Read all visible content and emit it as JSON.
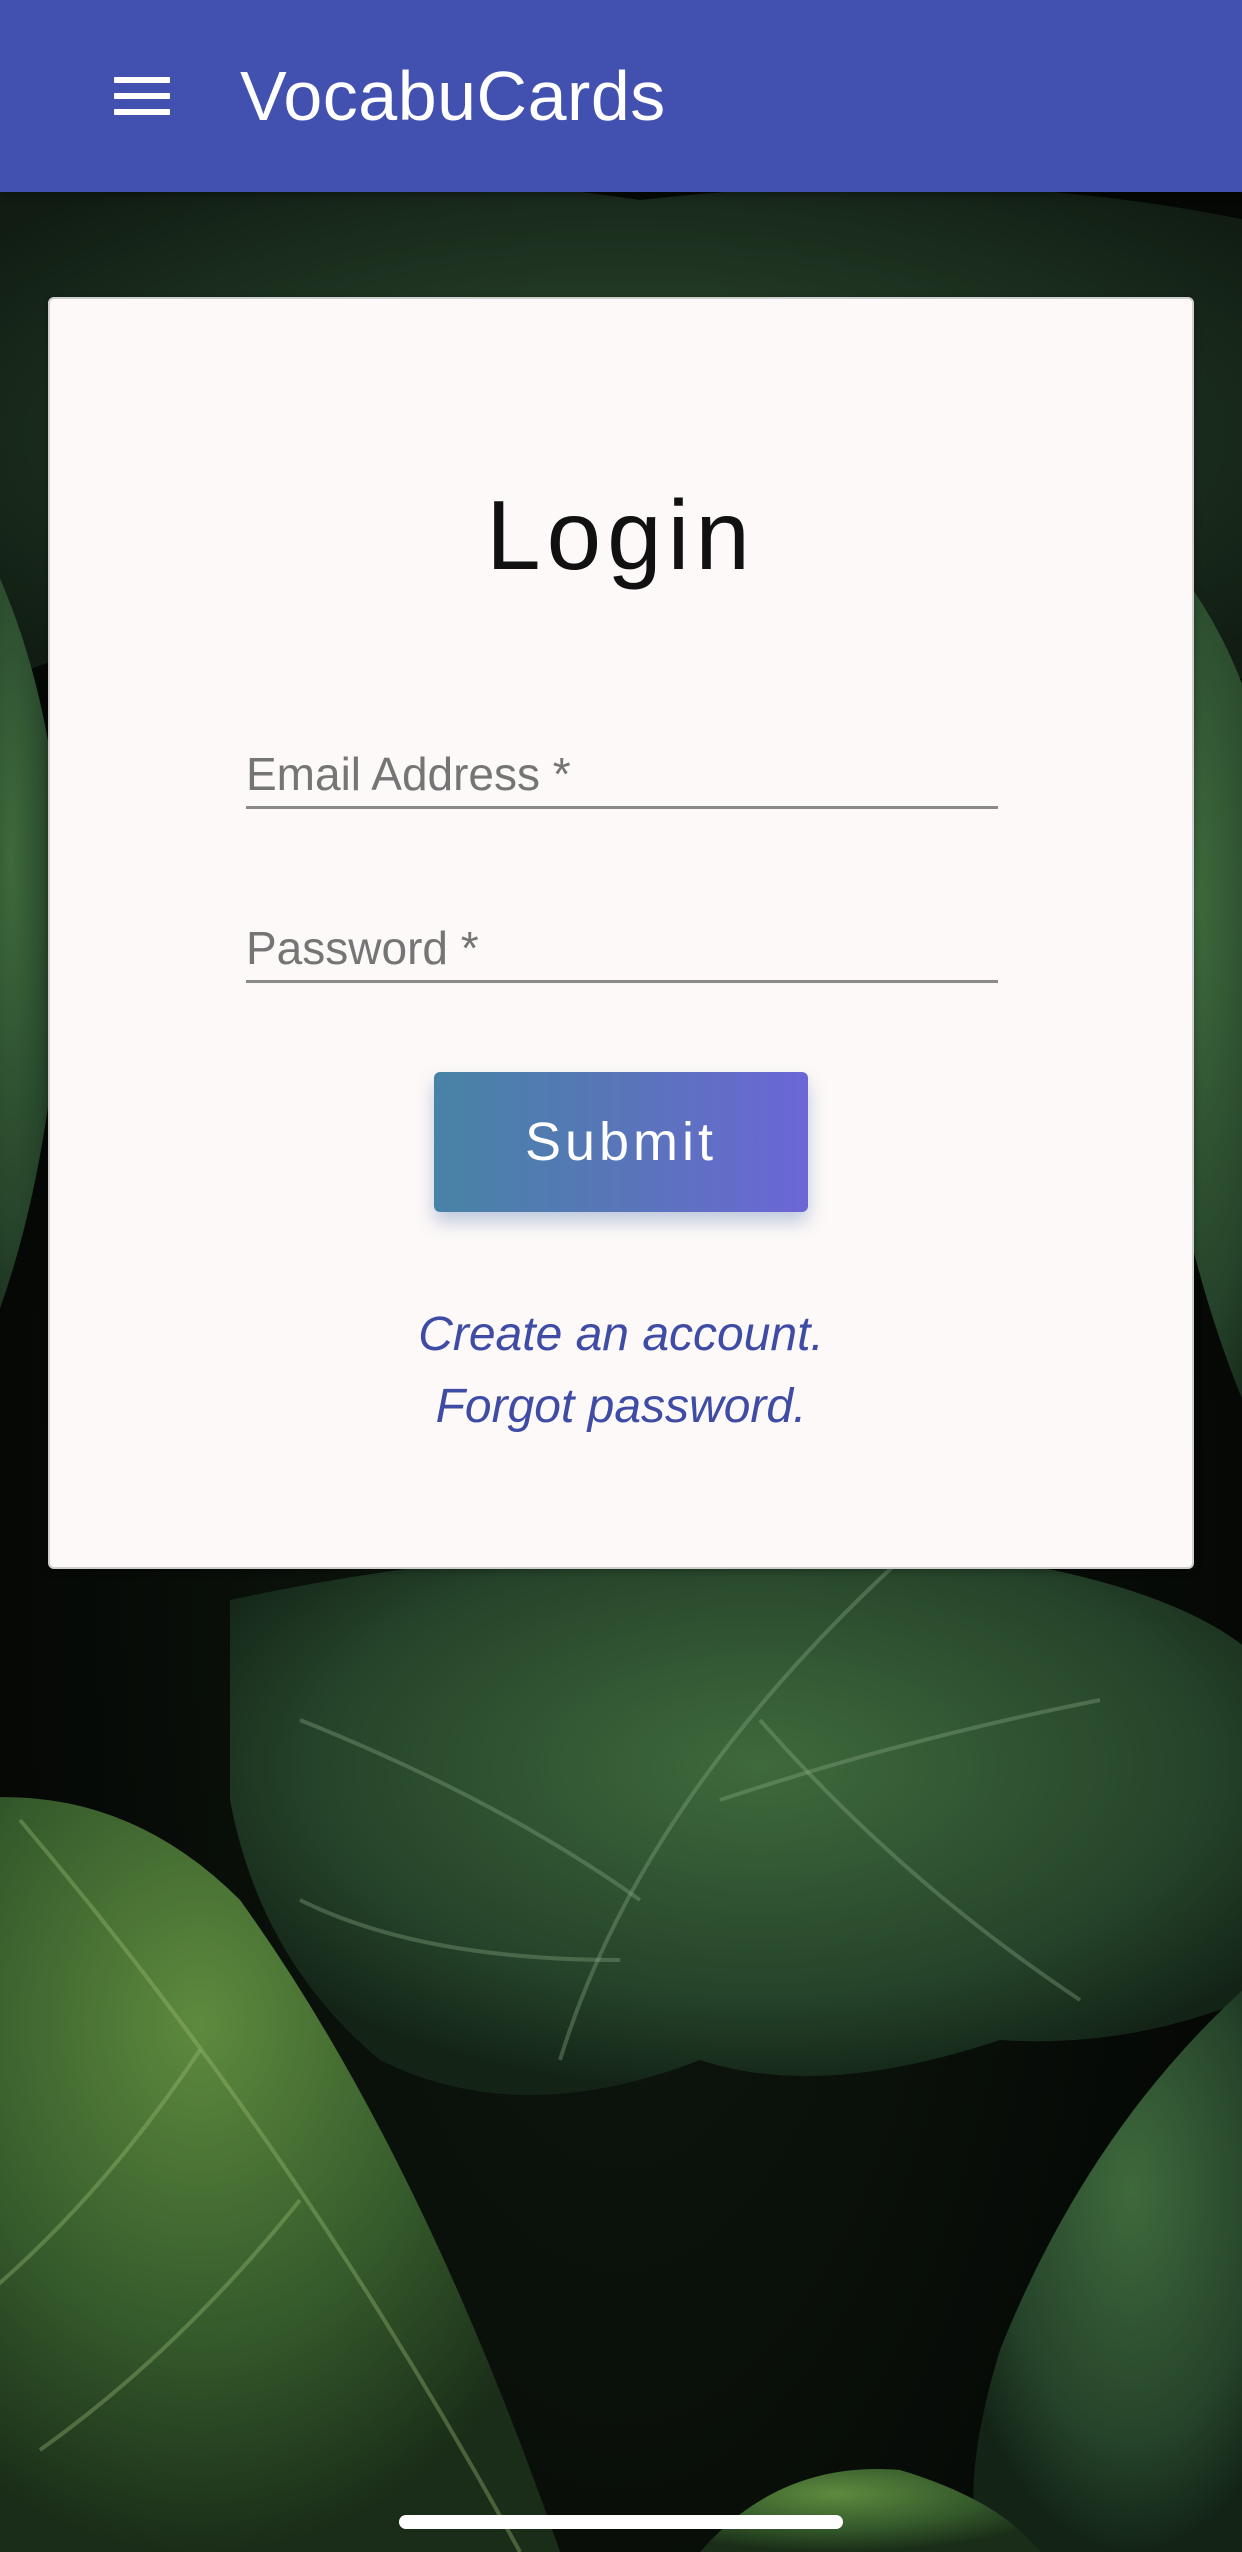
{
  "app_bar": {
    "title": "VocabuCards",
    "menu_icon": "hamburger-menu-icon",
    "color": "#4251b0"
  },
  "login": {
    "title": "Login",
    "email_label": "Email Address *",
    "email_value": "",
    "password_label": "Password *",
    "password_value": "",
    "submit_label": "Submit",
    "create_account_link": "Create an account.",
    "forgot_password_link": "Forgot password."
  },
  "colors": {
    "card_background": "#fdf9f8",
    "link": "#3f4ca6",
    "button_gradient_start": "#4783a5",
    "button_gradient_end": "#6c66d6"
  },
  "background": {
    "image": "green-leaves-photo"
  }
}
